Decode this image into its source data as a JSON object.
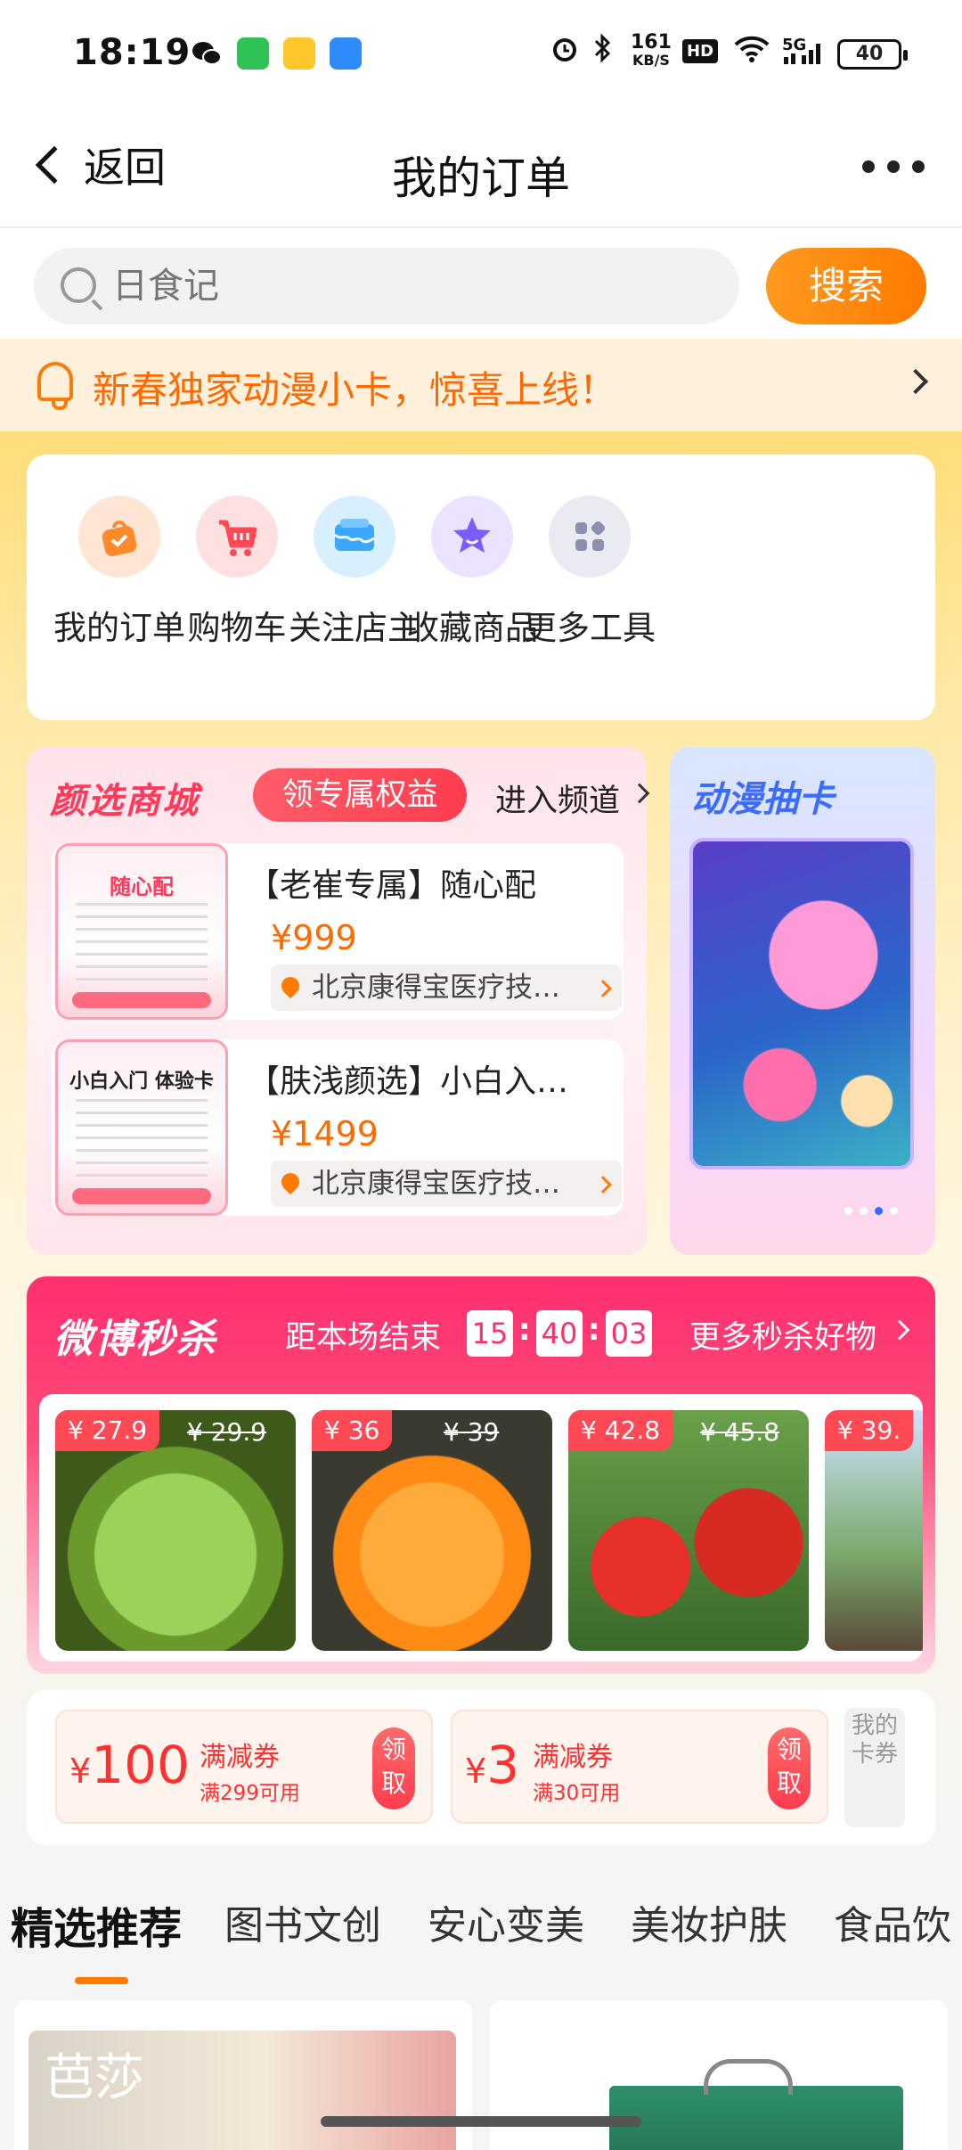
{
  "status_bar": {
    "time": "18:19",
    "net_speed": "161",
    "net_unit": "KB/S",
    "hd": "HD",
    "network": "5G",
    "battery": "40"
  },
  "header": {
    "back_label": "返回",
    "title": "我的订单"
  },
  "search": {
    "placeholder": "日食记",
    "button": "搜索"
  },
  "notice": {
    "text": "新春独家动漫小卡，惊喜上线！"
  },
  "tools": [
    {
      "label": "我的订单",
      "icon": "bag-icon",
      "color": "#ff8a2a"
    },
    {
      "label": "购物车",
      "icon": "cart-icon",
      "color": "#ff4a55"
    },
    {
      "label": "关注店主",
      "icon": "shop-icon",
      "color": "#3aa8ff"
    },
    {
      "label": "收藏商品",
      "icon": "star-icon",
      "color": "#7a5cff"
    },
    {
      "label": "更多工具",
      "icon": "grid-icon",
      "color": "#8c8fb0"
    }
  ],
  "yanxuan": {
    "title": "颜选商城",
    "benefit_button": "领专属权益",
    "enter_link": "进入频道",
    "products": [
      {
        "name": "【老崔专属】随心配",
        "price": "¥999",
        "shop": "北京康得宝医疗技…",
        "thumb_title": "随心配"
      },
      {
        "name": "【肤浅颜选】小白入…",
        "price": "¥1499",
        "shop": "北京康得宝医疗技…",
        "thumb_title": "小白入门 体验卡"
      }
    ]
  },
  "anime": {
    "title": "动漫抽卡",
    "dots": 4,
    "active_dot": 2
  },
  "flash_sale": {
    "title": "微博秒杀",
    "subtitle": "距本场结束",
    "countdown": {
      "h": "15",
      "m": "40",
      "s": "03"
    },
    "more_link": "更多秒杀好物",
    "items": [
      {
        "price": "¥ 27.9",
        "original": "¥ 29.9",
        "product": "cucumbers"
      },
      {
        "price": "¥ 36",
        "original": "¥ 39",
        "product": "orange"
      },
      {
        "price": "¥ 42.8",
        "original": "¥ 45.8",
        "product": "tomatoes"
      },
      {
        "price": "¥ 39.",
        "original": "",
        "product": "bottle"
      }
    ]
  },
  "coupons": [
    {
      "currency": "¥",
      "amount": "100",
      "type": "满减券",
      "condition": "满299可用",
      "button": "领取"
    },
    {
      "currency": "¥",
      "amount": "3",
      "type": "满减券",
      "condition": "满30可用",
      "button": "领取"
    }
  ],
  "my_cards": "我的卡券",
  "tabs": [
    "精选推荐",
    "图书文创",
    "安心变美",
    "美妆护肤",
    "食品饮"
  ],
  "active_tab": 0,
  "feed": {
    "card1_text": "芭莎"
  }
}
